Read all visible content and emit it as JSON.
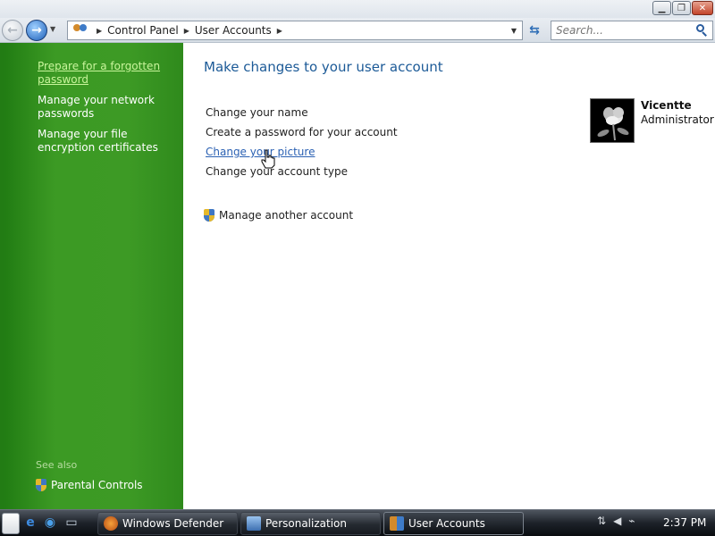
{
  "window": {
    "caption_buttons": [
      "minimize",
      "maximize",
      "close"
    ]
  },
  "nav": {
    "breadcrumbs": [
      "Control Panel",
      "User Accounts"
    ],
    "search_placeholder": "Search..."
  },
  "sidebar": {
    "links": [
      {
        "label": "Prepare for a forgotten password",
        "active": true
      },
      {
        "label": "Manage your network passwords",
        "active": false
      },
      {
        "label": "Manage your file encryption certificates",
        "active": false
      }
    ],
    "see_also_label": "See also",
    "see_also_items": [
      {
        "label": "Parental Controls",
        "icon": "shield-icon"
      }
    ],
    "colors": {
      "background": "#3d9a25",
      "active_link": "#c8f59b"
    }
  },
  "main": {
    "title": "Make changes to your user account",
    "tasks": [
      {
        "label": "Change your name",
        "hover": false
      },
      {
        "label": "Create a password for your account",
        "hover": false
      },
      {
        "label": "Change your picture",
        "hover": true
      },
      {
        "label": "Change your account type",
        "hover": false
      }
    ],
    "manage_another": "Manage another account",
    "account": {
      "name": "Vicentte",
      "role": "Administrator",
      "picture_icon": "flower-picture"
    },
    "colors": {
      "title": "#1c5a97",
      "link": "#2b61b3"
    }
  },
  "taskbar": {
    "quick_launch": [
      "ie-icon",
      "ie-icon",
      "show-desktop-icon"
    ],
    "buttons": [
      {
        "label": "Windows Defender",
        "active": false
      },
      {
        "label": "Personalization",
        "active": false
      },
      {
        "label": "User Accounts",
        "active": true
      }
    ],
    "tray_icons": [
      "network-icon",
      "volume-icon",
      "power-icon"
    ],
    "clock": "2:37 PM"
  }
}
